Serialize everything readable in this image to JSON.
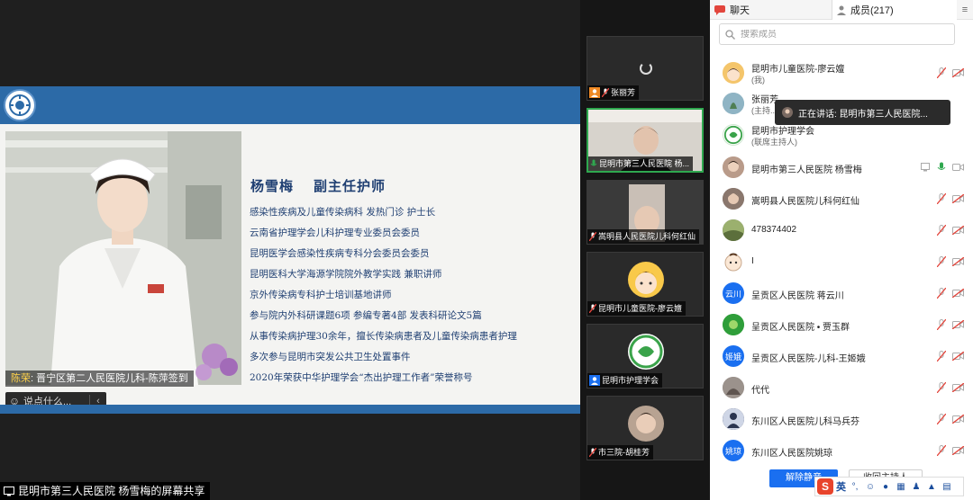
{
  "share": {
    "screen_share_label": "昆明市第三人民医院   杨雪梅的屏幕共享",
    "name_tag_name": "陈荣",
    "name_tag_text": "晋宁区第二人民医院儿科-陈萍签到",
    "speak_placeholder": "说点什么..."
  },
  "slide": {
    "title_name": "杨雪梅",
    "title_role": "副主任护师",
    "lines": [
      "感染性疾病及儿童传染病科 发热门诊  护士长",
      "云南省护理学会儿科护理专业委员会委员",
      "昆明医学会感染性疾病专科分会委员会委员",
      "昆明医科大学海源学院院外教学实践   兼职讲师",
      "京外传染病专科护士培训基地讲师",
      "参与院内外科研课题6项  参编专著4部  发表科研论文5篇",
      "从事传染病护理30余年，擅长传染病患者及儿童传染病患者护理",
      "多次参与昆明市突发公共卫生处置事件",
      "2020年荣获中华护理学会“杰出护理工作者”荣誉称号"
    ]
  },
  "video_tiles": [
    {
      "label": "张丽芳"
    },
    {
      "label": "昆明市第三人民医院   杨..."
    },
    {
      "label": "嵩明县人民医院儿科何红仙"
    },
    {
      "label": "昆明市儿童医院-廖云嬗"
    },
    {
      "label": "昆明市护理学会"
    },
    {
      "label": "市三院-胡桂芳"
    }
  ],
  "sidebar": {
    "tab_chat": "聊天",
    "tab_members": "成员(217)",
    "search_placeholder": "搜索成员",
    "speaking_tip": "正在讲话: 昆明市第三人民医院...",
    "members": [
      {
        "name": "昆明市儿童医院-廖云嬗",
        "sub": "(我)",
        "avatar_text": ""
      },
      {
        "name": "张丽芳",
        "sub": "(主持...",
        "avatar_text": ""
      },
      {
        "name": "昆明市护理学会",
        "sub": "(联席主持人)",
        "avatar_text": ""
      },
      {
        "name": "昆明市第三人民医院   杨雪梅",
        "sub": "",
        "avatar_text": ""
      },
      {
        "name": "嵩明县人民医院儿科何红仙",
        "sub": "",
        "avatar_text": ""
      },
      {
        "name": "478374402",
        "sub": "",
        "avatar_text": ""
      },
      {
        "name": "I",
        "sub": "",
        "avatar_text": ""
      },
      {
        "name": "呈贡区人民医院  蒋云川",
        "sub": "",
        "avatar_text": "云川"
      },
      {
        "name": "呈贡区人民医院 • 贾玉群",
        "sub": "",
        "avatar_text": ""
      },
      {
        "name": "呈贡区人民医院-儿科-王姬娥",
        "sub": "",
        "avatar_text": "姬娥"
      },
      {
        "name": "代代",
        "sub": "",
        "avatar_text": ""
      },
      {
        "name": "东川区人民医院儿科马兵芬",
        "sub": "",
        "avatar_text": ""
      },
      {
        "name": "东川区人民医院姚琼",
        "sub": "",
        "avatar_text": "姚琼"
      }
    ],
    "unmute_all": "解除静音",
    "reclaim_host": "收回主持人",
    "ime_label": "英"
  },
  "colors": {
    "accent": "#1a6ff0",
    "slide_header": "#2c6aa7",
    "slide_text": "#1f3f72",
    "active_speaker": "#2fa84f",
    "muted_red": "#e2453c"
  }
}
